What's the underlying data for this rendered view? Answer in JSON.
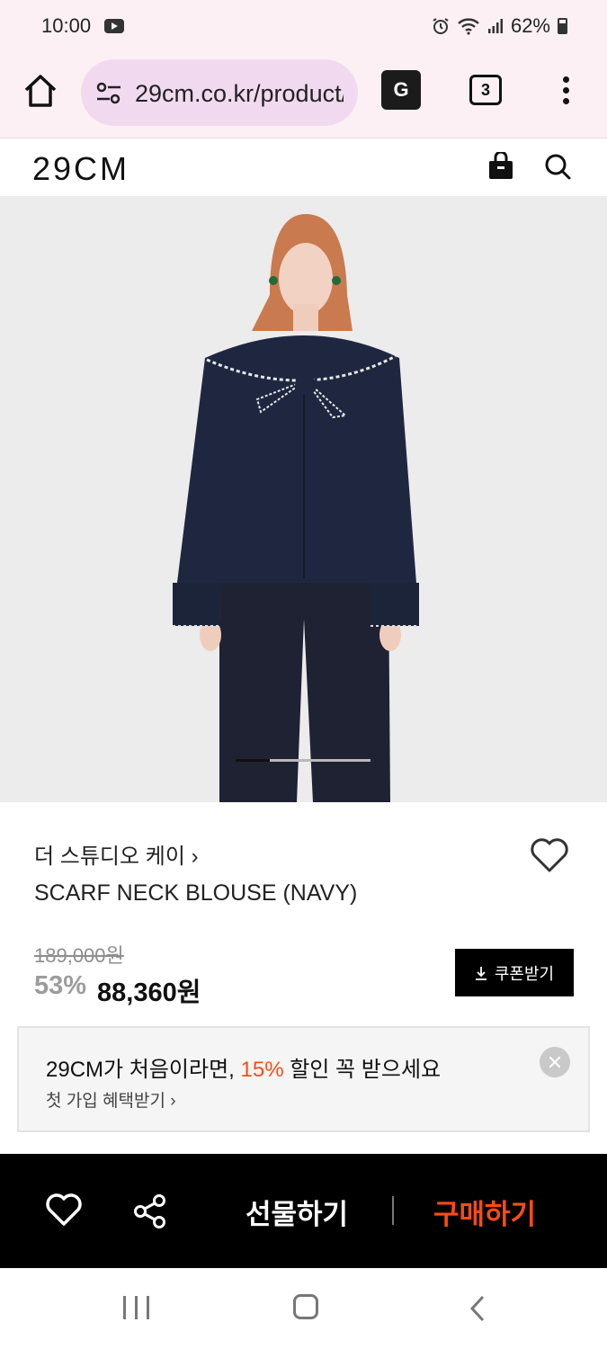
{
  "status_bar": {
    "time": "10:00",
    "battery_text": "62%",
    "icons": [
      "youtube-icon",
      "alarm-icon",
      "wifi-icon",
      "signal-icon",
      "battery-icon"
    ]
  },
  "browser": {
    "url": "29cm.co.kr/product/",
    "tab_count": "3",
    "translate_label": "G"
  },
  "site": {
    "logo": "29CM"
  },
  "product": {
    "brand": "더 스튜디오 케이",
    "brand_chevron": "›",
    "name": "SCARF NECK BLOUSE (NAVY)",
    "original_price": "189,000원",
    "discount_rate": "53%",
    "sale_price": "88,360원",
    "coupon_label": "쿠폰받기",
    "image_index": 1,
    "image_count": 4
  },
  "promo": {
    "text_before": "29CM가 처음이라면, ",
    "text_accent": "15%",
    "text_after": " 할인 꼭 받으세요",
    "sub_text": "첫 가입 혜택받기 ›"
  },
  "actions": {
    "gift_label": "선물하기",
    "buy_label": "구매하기"
  },
  "colors": {
    "accent": "#ff4b14",
    "browser_bg": "#fdf0f4",
    "url_pill": "#f1daf0",
    "action_bar": "#000000"
  }
}
